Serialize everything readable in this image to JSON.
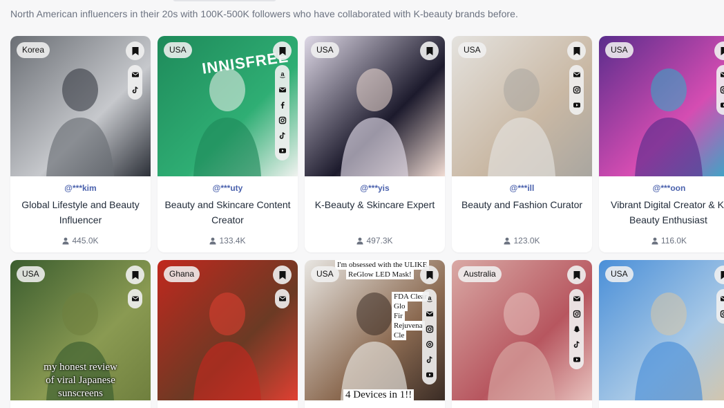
{
  "search": {
    "query_text": "North American influencers in their 20s with 100K-500K followers who have collaborated with K-beauty brands before."
  },
  "row1": [
    {
      "country": "Korea",
      "handle": "@***kim",
      "title": "Global Lifestyle and Beauty Influencer",
      "followers": "445.0K",
      "socials": [
        "mail-icon",
        "tiktok-icon"
      ],
      "photo_colors": [
        "#6a6e74",
        "#c6c8cc",
        "#2c3038"
      ]
    },
    {
      "country": "USA",
      "handle": "@***uty",
      "title": "Beauty and Skincare Content Creator",
      "followers": "133.4K",
      "socials": [
        "amazon-icon",
        "mail-icon",
        "facebook-icon",
        "instagram-icon",
        "tiktok-icon",
        "youtube-icon"
      ],
      "photo_colors": [
        "#1e8a5a",
        "#2fae74",
        "#f0f2ef"
      ],
      "photo_text": "INNISFREE"
    },
    {
      "country": "USA",
      "handle": "@***yis",
      "title": "K-Beauty & Skincare Expert",
      "followers": "497.3K",
      "socials": [],
      "photo_colors": [
        "#ded8e6",
        "#1c1a2c",
        "#f1dcd3"
      ]
    },
    {
      "country": "USA",
      "handle": "@***ill",
      "title": "Beauty and Fashion Curator",
      "followers": "123.0K",
      "socials": [
        "mail-icon",
        "instagram-icon",
        "youtube-icon"
      ],
      "photo_colors": [
        "#e4e2de",
        "#c9b8a4",
        "#a9a6a0"
      ]
    },
    {
      "country": "USA",
      "handle": "@***oon",
      "title": "Vibrant Digital Creator & K Beauty Enthusiast",
      "title_line1": "Vibrant Digital Creator & K",
      "title_line2": "Beauty Enthusiast",
      "followers": "116.0K",
      "socials": [
        "mail-icon",
        "instagram-icon",
        "youtube-icon"
      ],
      "photo_colors": [
        "#5a2d8c",
        "#d54db2",
        "#2cb0c8"
      ]
    }
  ],
  "row2": [
    {
      "country": "USA",
      "socials": [
        "mail-icon"
      ],
      "overlay_lines": [
        "my honest review",
        "of viral Japanese",
        "sunscreens"
      ],
      "photo_colors": [
        "#3b5d2f",
        "#8a9a52",
        "#6f7f3e"
      ]
    },
    {
      "country": "Ghana",
      "socials": [
        "mail-icon"
      ],
      "photo_colors": [
        "#c1281e",
        "#6b3a24",
        "#e04032"
      ]
    },
    {
      "country": "USA",
      "socials": [
        "amazon-icon",
        "mail-icon",
        "instagram-icon",
        "threads-icon",
        "tiktok-icon",
        "youtube-icon"
      ],
      "box_top_lines": [
        "I'm obsessed with the ULIKE",
        "ReGlow LED Mask!"
      ],
      "box_side_lines": [
        "FDA Clear",
        "Glo",
        "Fir",
        "Rejuvena",
        "Cle"
      ],
      "box_bottom": "4 Devices in 1!!",
      "photo_colors": [
        "#e8e6e2",
        "#8c6b52",
        "#3a2c25"
      ]
    },
    {
      "country": "Australia",
      "socials": [
        "mail-icon",
        "instagram-icon",
        "snapchat-icon",
        "tiktok-icon",
        "youtube-icon"
      ],
      "photo_colors": [
        "#d9a9a5",
        "#b7565f",
        "#e8c3bf"
      ]
    },
    {
      "country": "USA",
      "socials": [
        "mail-icon",
        "instagram-icon"
      ],
      "photo_colors": [
        "#4a8fd8",
        "#a7c8e6",
        "#d8c6a6"
      ]
    }
  ],
  "icons": {
    "bookmark": "bookmark-icon",
    "person": "person-icon"
  },
  "colors": {
    "handle": "#4b62ad",
    "background": "#f7f7f8"
  }
}
